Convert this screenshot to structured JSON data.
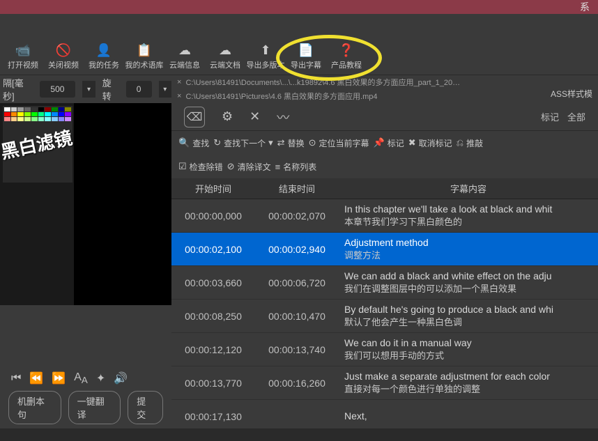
{
  "topbar": {
    "sys_label": "系"
  },
  "toolbar": {
    "items": [
      {
        "label": "打开视频",
        "icon": "📹"
      },
      {
        "label": "关闭视频",
        "icon": "🚫"
      },
      {
        "label": "我的任务",
        "icon": "👤"
      },
      {
        "label": "我的术语库",
        "icon": "📋"
      },
      {
        "label": "云端信息",
        "icon": "☁"
      },
      {
        "label": "云端文档",
        "icon": "☁"
      },
      {
        "label": "导出多版本",
        "icon": "⬆"
      },
      {
        "label": "导出字幕",
        "icon": "📄"
      },
      {
        "label": "产品教程",
        "icon": "❓"
      }
    ]
  },
  "controls": {
    "gap_label": "隔[毫秒]",
    "gap_value": "500",
    "rotate_label": "旋转",
    "rotate_value": "0"
  },
  "files": {
    "line1": "C:\\Users\\81491\\Documents\\...\\...k19892\\4.6 黑白效果的多方面应用_part_1_20…",
    "line2": "C:\\Users\\81491\\Pictures\\4.6 黑白效果的多方面应用.mp4"
  },
  "ass_button": "ASS样式模",
  "preview_overlay": "黑白滤镜",
  "tabs_right": {
    "mark": "标记",
    "all": "全部"
  },
  "actions": {
    "find": "查找",
    "find_next": "查找下一个",
    "replace": "替换",
    "locate": "定位当前字幕",
    "mark": "标记",
    "unmark": "取消标记",
    "undo": "推敲",
    "check": "检查除错",
    "clear_trans": "清除译文",
    "name_list": "名称列表"
  },
  "checkbox_checked": true,
  "table": {
    "head_start": "开始时间",
    "head_end": "结束时间",
    "head_content": "字幕内容",
    "rows": [
      {
        "start": "00:00:00,000",
        "end": "00:00:02,070",
        "en": "In this chapter we'll take a look at black and whit",
        "cn": "本章节我们学习下黑白颜色的",
        "selected": false
      },
      {
        "start": "00:00:02,100",
        "end": "00:00:02,940",
        "en": "Adjustment method",
        "cn": "调整方法",
        "selected": true
      },
      {
        "start": "00:00:03,660",
        "end": "00:00:06,720",
        "en": "We can add a black and white effect on the adju",
        "cn": "我们在调整图层中的可以添加一个黑白效果",
        "selected": false
      },
      {
        "start": "00:00:08,250",
        "end": "00:00:10,470",
        "en": "By default he's going to produce a black and whi",
        "cn": "默认了他会产生一种黑白色调",
        "selected": false
      },
      {
        "start": "00:00:12,120",
        "end": "00:00:13,740",
        "en": "We can do it in a manual way",
        "cn": "我们可以想用手动的方式",
        "selected": false
      },
      {
        "start": "00:00:13,770",
        "end": "00:00:16,260",
        "en": "Just make a separate adjustment for each color",
        "cn": "直接对每一个颜色进行单独的调整",
        "selected": false
      },
      {
        "start": "00:00:17,130",
        "end": "",
        "en": "Next,",
        "cn": "",
        "selected": false
      }
    ]
  },
  "bottom": {
    "btn_del": "机删本句",
    "btn_trans": "一键翻译",
    "btn_submit": "提交"
  },
  "palette_colors": [
    [
      "#fff",
      "#ccc",
      "#999",
      "#666",
      "#333",
      "#000",
      "#800",
      "#080",
      "#008",
      "#880"
    ],
    [
      "#f00",
      "#f80",
      "#ff0",
      "#8f0",
      "#0f0",
      "#0f8",
      "#0ff",
      "#08f",
      "#00f",
      "#80f"
    ],
    [
      "#f88",
      "#fc8",
      "#ff8",
      "#cf8",
      "#8f8",
      "#8fc",
      "#8ff",
      "#8cf",
      "#88f",
      "#c8f"
    ]
  ]
}
